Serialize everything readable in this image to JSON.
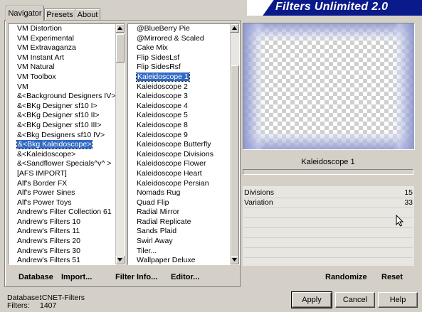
{
  "tabs": [
    "Navigator",
    "Presets",
    "About"
  ],
  "title": "Filters Unlimited 2.0",
  "categories": {
    "items": [
      "VM Distortion",
      "VM Experimental",
      "VM Extravaganza",
      "VM Instant Art",
      "VM Natural",
      "VM Toolbox",
      "VM",
      "&<Background Designers IV>",
      "&<BKg Designer sf10 I>",
      "&<BKg Designer sf10 II>",
      "&<BKg Designer sf10 III>",
      "&<Bkg Designers sf10 IV>",
      "&<Bkg Kaleidoscope>",
      "&<Kaleidoscope>",
      "&<Sandflower Specials^v^ >",
      "[AFS IMPORT]",
      "Alf's Border FX",
      "Alf's Power Sines",
      "Alf's Power Toys",
      "Andrew's Filter Collection 61",
      "Andrew's Filters 10",
      "Andrew's Filters 11",
      "Andrew's Filters 20",
      "Andrew's Filters 30",
      "Andrew's Filters 51"
    ],
    "selected_index": 12
  },
  "filters": {
    "items": [
      "@BlueBerry Pie",
      "@Mirrored & Scaled",
      "Cake Mix",
      "Flip SidesLsf",
      "Flip SidesRsf",
      "Kaleidoscope 1",
      "Kaleidoscope 2",
      "Kaleidoscope 3",
      "Kaleidoscope 4",
      "Kaleidoscope 5",
      "Kaleidoscope 8",
      "Kaleidoscope 9",
      "Kaleidoscope Butterfly",
      "Kaleidoscope Divisions",
      "Kaleidoscope Flower",
      "Kaleidoscope Heart",
      "Kaleidoscope Persian",
      "Nomads Rug",
      "Quad Flip",
      "Radial Mirror",
      "Radial Replicate",
      "Sands Plaid",
      "Swirl Away",
      "Tiler...",
      "Wallpaper Deluxe"
    ],
    "selected_index": 5
  },
  "links": {
    "database": "Database",
    "import": "Import...",
    "filter_info": "Filter Info...",
    "editor": "Editor..."
  },
  "preview": {
    "filter_name": "Kaleidoscope 1"
  },
  "params": [
    {
      "label": "Divisions",
      "value": "15"
    },
    {
      "label": "Variation",
      "value": "33"
    }
  ],
  "param_buttons": {
    "randomize": "Randomize",
    "reset": "Reset"
  },
  "footer": {
    "database_label": "Database:",
    "database_value": "ICNET-Filters",
    "filters_label": "Filters:",
    "filters_value": "1407"
  },
  "buttons": {
    "apply": "Apply",
    "cancel": "Cancel",
    "help": "Help"
  },
  "colors": {
    "banner": "#0b1a8a",
    "selection": "#316ac5",
    "face": "#d4d0c8"
  },
  "icons": [
    "scroll-up-arrow-icon",
    "scroll-down-arrow-icon",
    "mouse-pointer-icon"
  ]
}
